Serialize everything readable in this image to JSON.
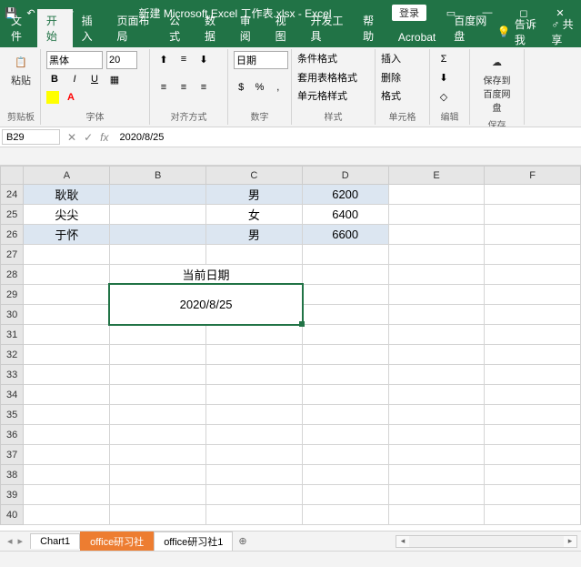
{
  "title": "新建 Microsoft Excel 工作表.xlsx - Excel",
  "login": "登录",
  "menu": {
    "tabs": [
      "文件",
      "开始",
      "插入",
      "页面布局",
      "公式",
      "数据",
      "审阅",
      "视图",
      "开发工具",
      "帮助",
      "Acrobat",
      "百度网盘"
    ],
    "tellme": "告诉我",
    "share": "共享"
  },
  "ribbon": {
    "clipboard": {
      "label": "剪贴板",
      "paste": "粘贴"
    },
    "font": {
      "label": "字体",
      "name": "黑体",
      "size": "20"
    },
    "align": {
      "label": "对齐方式"
    },
    "number": {
      "label": "数字",
      "format": "日期"
    },
    "styles": {
      "label": "样式",
      "cond": "条件格式",
      "table": "套用表格格式",
      "cell": "单元格样式"
    },
    "cells": {
      "label": "单元格",
      "insert": "插入",
      "delete": "删除",
      "format": "格式"
    },
    "editing": {
      "label": "编辑"
    },
    "baidu": {
      "label": "保存",
      "btn": "保存到百度网盘"
    }
  },
  "namebox": "B29",
  "formula": "2020/8/25",
  "cols": [
    "A",
    "B",
    "C",
    "D",
    "E",
    "F"
  ],
  "rows": [
    24,
    25,
    26,
    27,
    28,
    29,
    30,
    31,
    32,
    33,
    34,
    35,
    36,
    37,
    38,
    39,
    40
  ],
  "data": {
    "r24": {
      "a": "耿耿",
      "c": "男",
      "d": "6200"
    },
    "r25": {
      "a": "尖尖",
      "c": "女",
      "d": "6400"
    },
    "r26": {
      "a": "于怀",
      "c": "男",
      "d": "6600"
    },
    "header_label": "当前日期",
    "date_value": "2020/8/25"
  },
  "sheets": {
    "s1": "Chart1",
    "s2": "office研习社",
    "s3": "office研习社1"
  }
}
